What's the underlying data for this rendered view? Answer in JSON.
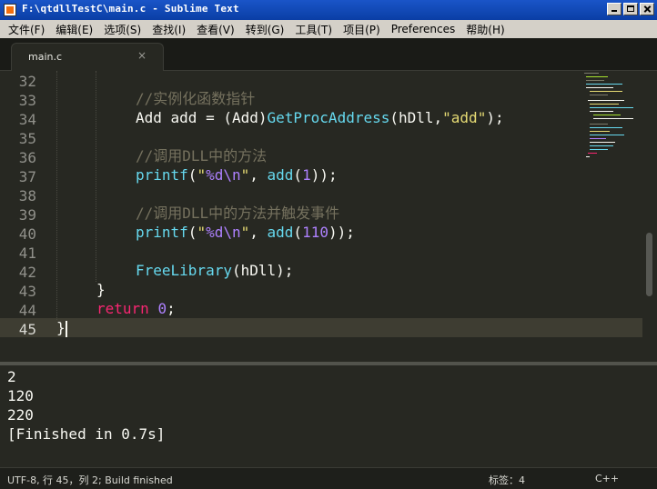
{
  "window": {
    "title": "F:\\qtdllTestC\\main.c - Sublime Text"
  },
  "menu": [
    {
      "label": "文件(F)"
    },
    {
      "label": "编辑(E)"
    },
    {
      "label": "选项(S)"
    },
    {
      "label": "查找(I)"
    },
    {
      "label": "查看(V)"
    },
    {
      "label": "转到(G)"
    },
    {
      "label": "工具(T)"
    },
    {
      "label": "项目(P)"
    },
    {
      "label": "Preferences"
    },
    {
      "label": "帮助(H)"
    }
  ],
  "tabs": [
    {
      "label": "main.c",
      "close": "×"
    }
  ],
  "editor": {
    "line_numbers": [
      "32",
      "33",
      "34",
      "35",
      "36",
      "37",
      "38",
      "39",
      "40",
      "41",
      "42",
      "43",
      "44",
      "45"
    ],
    "current_line": "45",
    "lines": {
      "l33_comment": "//实例化函数指针",
      "l34_a": "Add add = (Add)",
      "l34_fn": "GetProcAddress",
      "l34_b": "(hDll,",
      "l34_str": "\"add\"",
      "l34_c": ");",
      "l36_comment": "//调用DLL中的方法",
      "l37_fn": "printf",
      "l37_open": "(",
      "l37_q1": "\"",
      "l37_fmt": "%d",
      "l37_esc": "\\n",
      "l37_q2": "\"",
      "l37_sep": ", ",
      "l37_fn2": "add",
      "l37_p": "(",
      "l37_num": "1",
      "l37_close": "));",
      "l39_comment": "//调用DLL中的方法并触发事件",
      "l40_fn": "printf",
      "l40_open": "(",
      "l40_q1": "\"",
      "l40_fmt": "%d",
      "l40_esc": "\\n",
      "l40_q2": "\"",
      "l40_sep": ", ",
      "l40_fn2": "add",
      "l40_p": "(",
      "l40_num": "110",
      "l40_close": "));",
      "l42_fn": "FreeLibrary",
      "l42_rest": "(hDll);",
      "l43": "}",
      "l44_kw": "return",
      "l44_sp": " ",
      "l44_num": "0",
      "l44_end": ";",
      "l45": "}"
    }
  },
  "output": {
    "lines": [
      "2",
      "120",
      "220",
      "[Finished in 0.7s]"
    ]
  },
  "status": {
    "left": "UTF-8, 行 45，列 2; Build finished",
    "tab_size": "标签：4",
    "syntax": "C++"
  }
}
